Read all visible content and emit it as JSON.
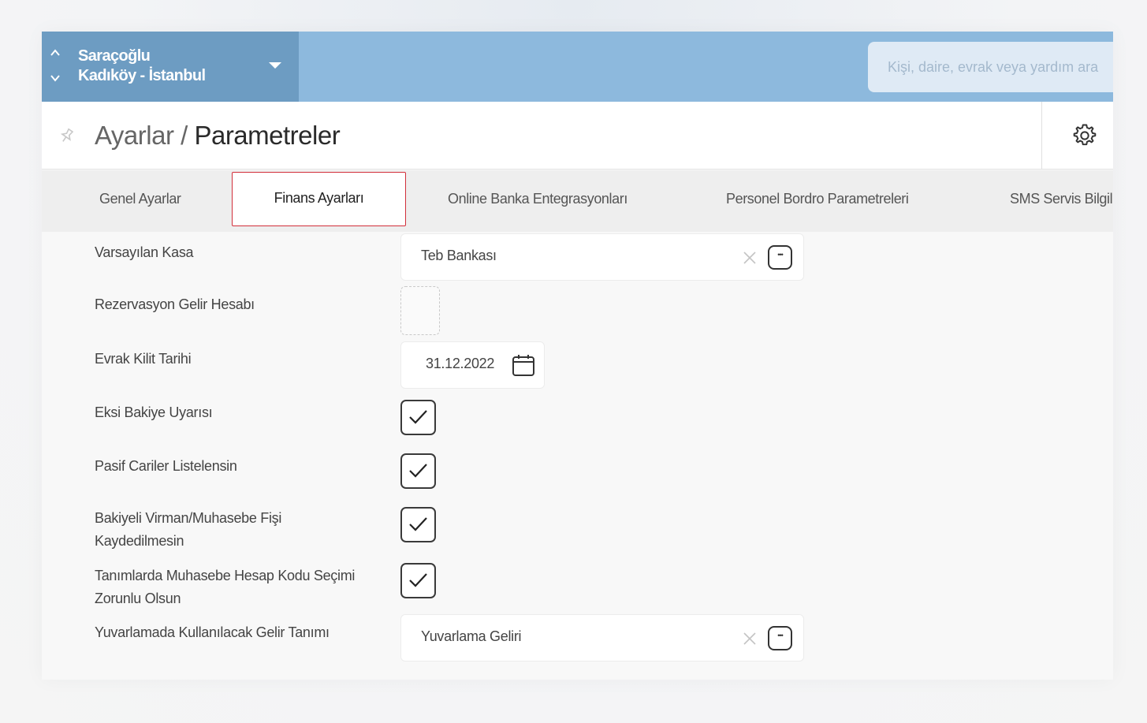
{
  "topbar": {
    "site_name": "Saraçoğlu",
    "site_location": "Kadıköy - İstanbul",
    "search_placeholder": "Kişi, daire, evrak veya yardım ara"
  },
  "header": {
    "breadcrumb_parent": "Ayarlar",
    "separator": " / ",
    "breadcrumb_current": "Parametreler"
  },
  "tabs": [
    {
      "label": "Genel Ayarlar"
    },
    {
      "label": "Finans Ayarları",
      "active": true
    },
    {
      "label": "Online Banka Entegrasyonları"
    },
    {
      "label": "Personel Bordro Parametreleri"
    },
    {
      "label": "SMS Servis Bilgileri"
    }
  ],
  "form": {
    "varsayilan_kasa": {
      "label": "Varsayılan Kasa",
      "value": "Teb Bankası"
    },
    "rezervasyon_gelir_hesabi": {
      "label": "Rezervasyon Gelir Hesabı"
    },
    "evrak_kilit_tarihi": {
      "label": "Evrak Kilit Tarihi",
      "value": "31.12.2022"
    },
    "eksi_bakiye_uyarisi": {
      "label": "Eksi Bakiye Uyarısı",
      "checked": true
    },
    "pasif_cariler": {
      "label": "Pasif Cariler Listelensin",
      "checked": true
    },
    "bakiyeli_virman": {
      "label_line1": "Bakiyeli Virman/Muhasebe Fişi",
      "label_line2": "Kaydedilmesin",
      "checked": true
    },
    "hesap_kodu_secimi": {
      "label_line1": "Tanımlarda Muhasebe Hesap Kodu Seçimi",
      "label_line2": "Zorunlu Olsun",
      "checked": true
    },
    "yuvarlama_gelir": {
      "label": "Yuvarlamada Kullanılacak Gelir Tanımı",
      "value": "Yuvarlama Geliri"
    }
  },
  "colors": {
    "topbar": "#8db9dd",
    "site_switcher": "#6d9cc2",
    "active_tab_border": "#d22f3a"
  }
}
